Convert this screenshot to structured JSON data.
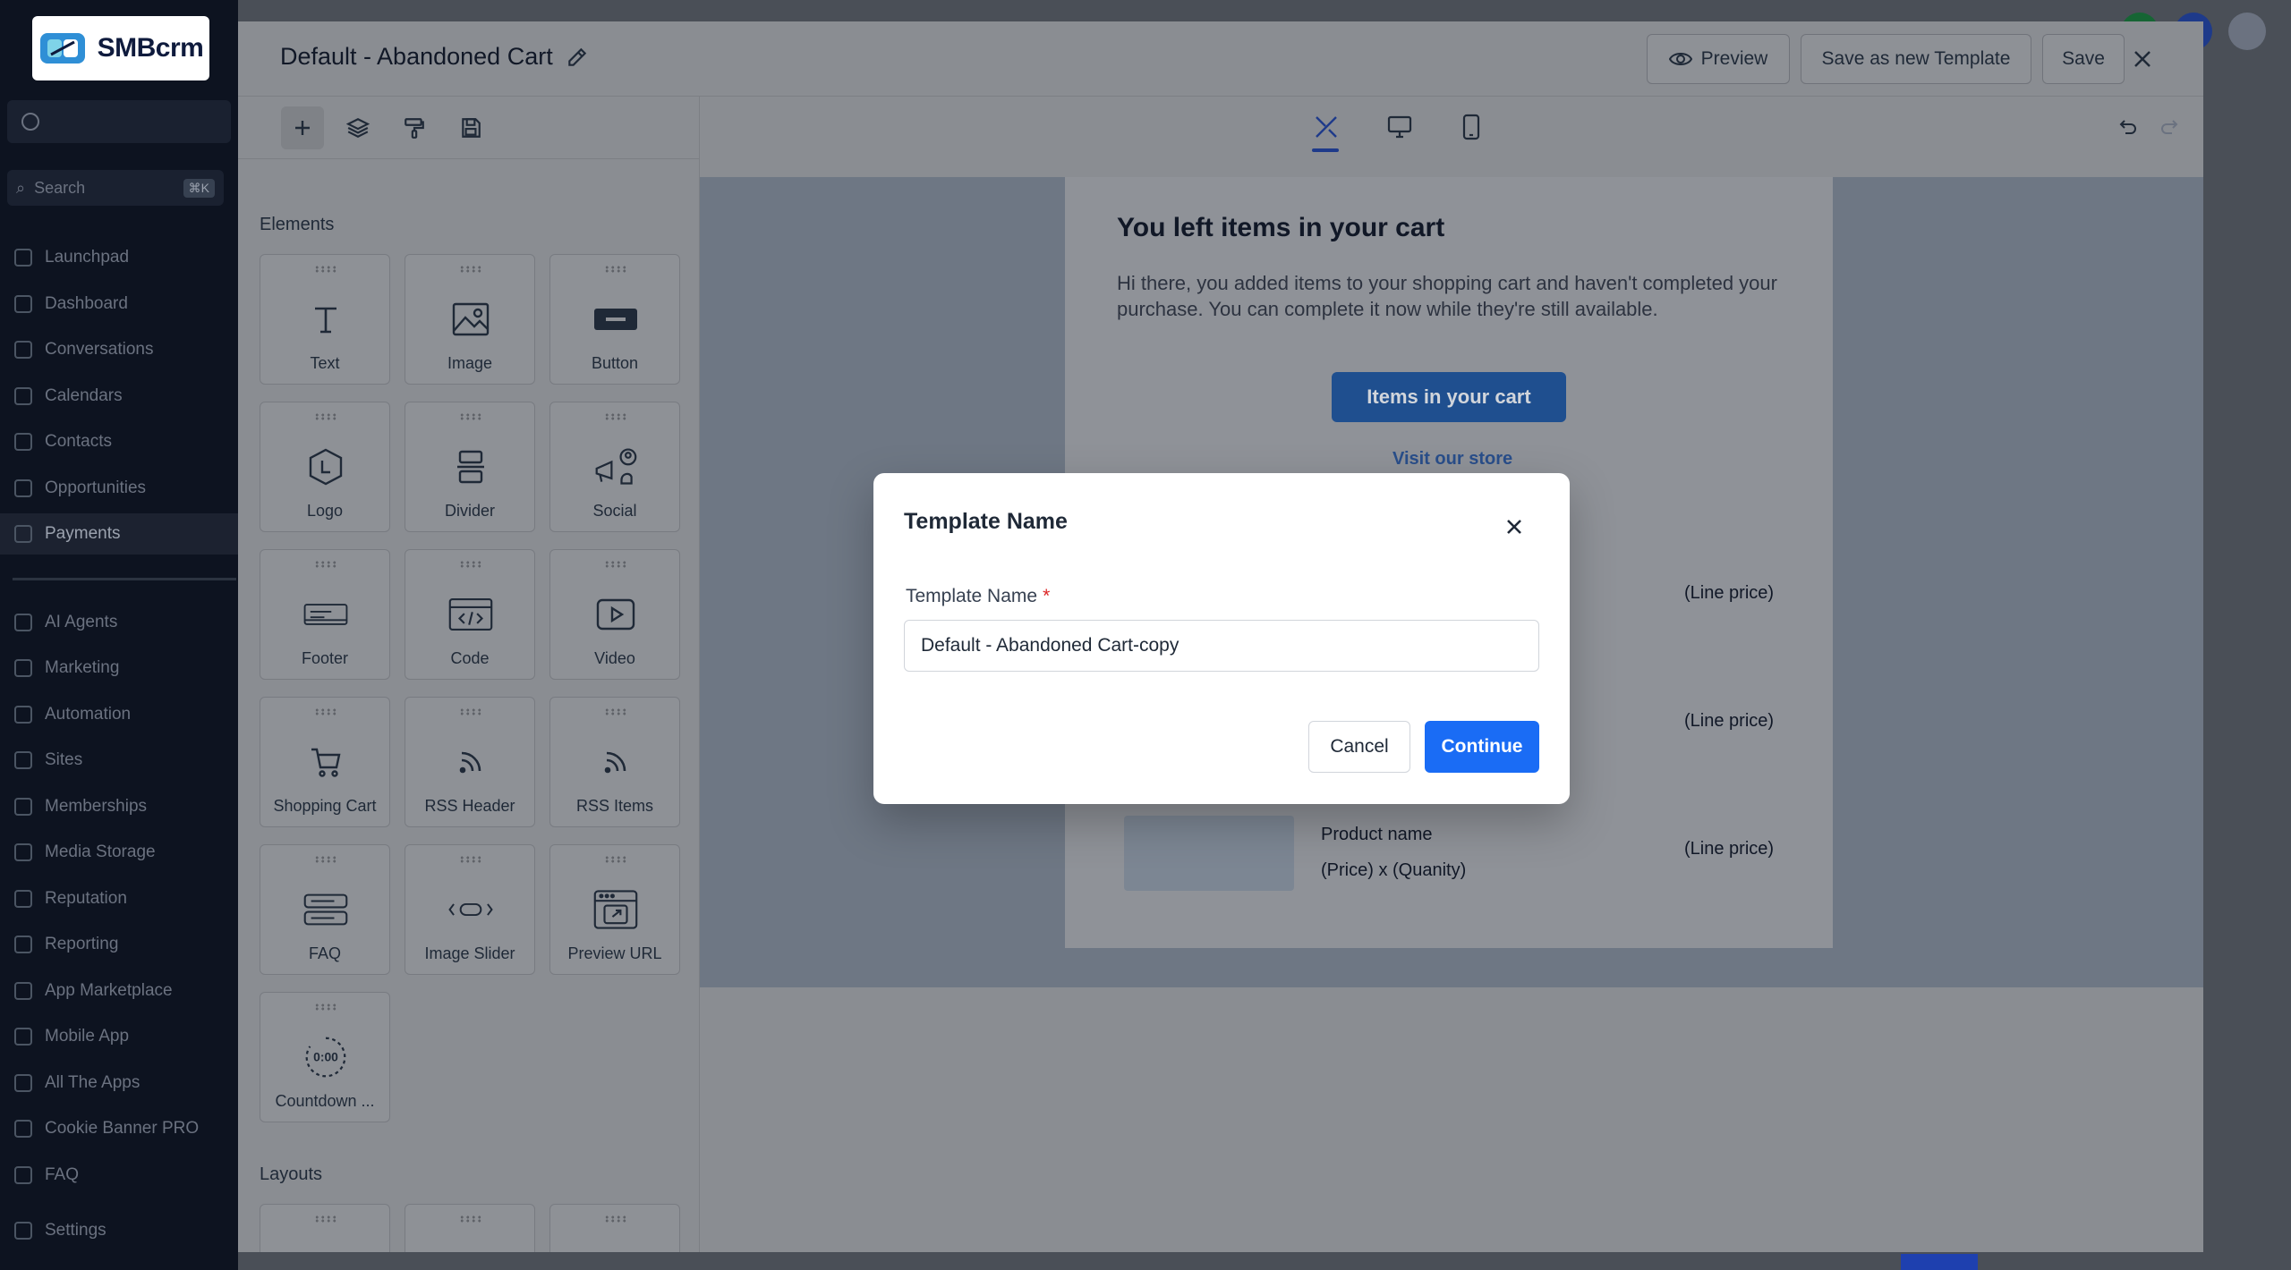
{
  "brand": {
    "name": "SMBcrm"
  },
  "sidebar": {
    "search_placeholder": "Search",
    "search_shortcut": "⌘K",
    "items": [
      {
        "label": "Launchpad",
        "top": 0
      },
      {
        "label": "Dashboard"
      },
      {
        "label": "Conversations"
      },
      {
        "label": "Calendars"
      },
      {
        "label": "Contacts"
      },
      {
        "label": "Opportunities"
      },
      {
        "label": "Payments"
      },
      {
        "label": "AI Agents"
      },
      {
        "label": "Marketing"
      },
      {
        "label": "Automation"
      },
      {
        "label": "Sites"
      },
      {
        "label": "Memberships"
      },
      {
        "label": "Media Storage"
      },
      {
        "label": "Reputation"
      },
      {
        "label": "Reporting"
      },
      {
        "label": "App Marketplace"
      },
      {
        "label": "Mobile App"
      },
      {
        "label": "All The Apps"
      },
      {
        "label": "Cookie Banner PRO"
      },
      {
        "label": "FAQ"
      },
      {
        "label": "Settings"
      }
    ]
  },
  "editor": {
    "title": "Default - Abandoned Cart",
    "preview_label": "Preview",
    "save_new_label": "Save as new Template",
    "save_label": "Save",
    "elements_heading": "Elements",
    "layouts_heading": "Layouts",
    "elements": [
      {
        "label": "Text",
        "icon": "text-icon"
      },
      {
        "label": "Image",
        "icon": "image-icon"
      },
      {
        "label": "Button",
        "icon": "button-icon"
      },
      {
        "label": "Logo",
        "icon": "logo-icon"
      },
      {
        "label": "Divider",
        "icon": "divider-icon"
      },
      {
        "label": "Social",
        "icon": "social-icon"
      },
      {
        "label": "Footer",
        "icon": "footer-icon"
      },
      {
        "label": "Code",
        "icon": "code-icon"
      },
      {
        "label": "Video",
        "icon": "video-icon"
      },
      {
        "label": "Shopping Cart",
        "icon": "shopping-cart-icon"
      },
      {
        "label": "RSS Header",
        "icon": "rss-icon"
      },
      {
        "label": "RSS Items",
        "icon": "rss-icon"
      },
      {
        "label": "FAQ",
        "icon": "faq-icon"
      },
      {
        "label": "Image Slider",
        "icon": "image-slider-icon"
      },
      {
        "label": "Preview URL",
        "icon": "preview-url-icon"
      },
      {
        "label": "Countdown ...",
        "icon": "countdown-icon",
        "glyph": "0:00"
      }
    ]
  },
  "email": {
    "heading": "You left items in your cart",
    "intro": "Hi there, you added items to your shopping cart and haven't completed your purchase. You can complete it now while they're still available.",
    "cta": "Items in your cart",
    "visit_link": "Visit our store",
    "line_price": "(Line price)",
    "product_name": "Product name",
    "product_qty": "(Price) x (Quanity)"
  },
  "modal": {
    "title": "Template Name",
    "field_label": "Template Name",
    "required_mark": "*",
    "field_value": "Default - Abandoned Cart-copy",
    "cancel_label": "Cancel",
    "continue_label": "Continue"
  },
  "colors": {
    "primary": "#1a6cf5",
    "overlay": "#8a8d92",
    "sidebar": "#0d1320",
    "danger": "#dc2626"
  }
}
